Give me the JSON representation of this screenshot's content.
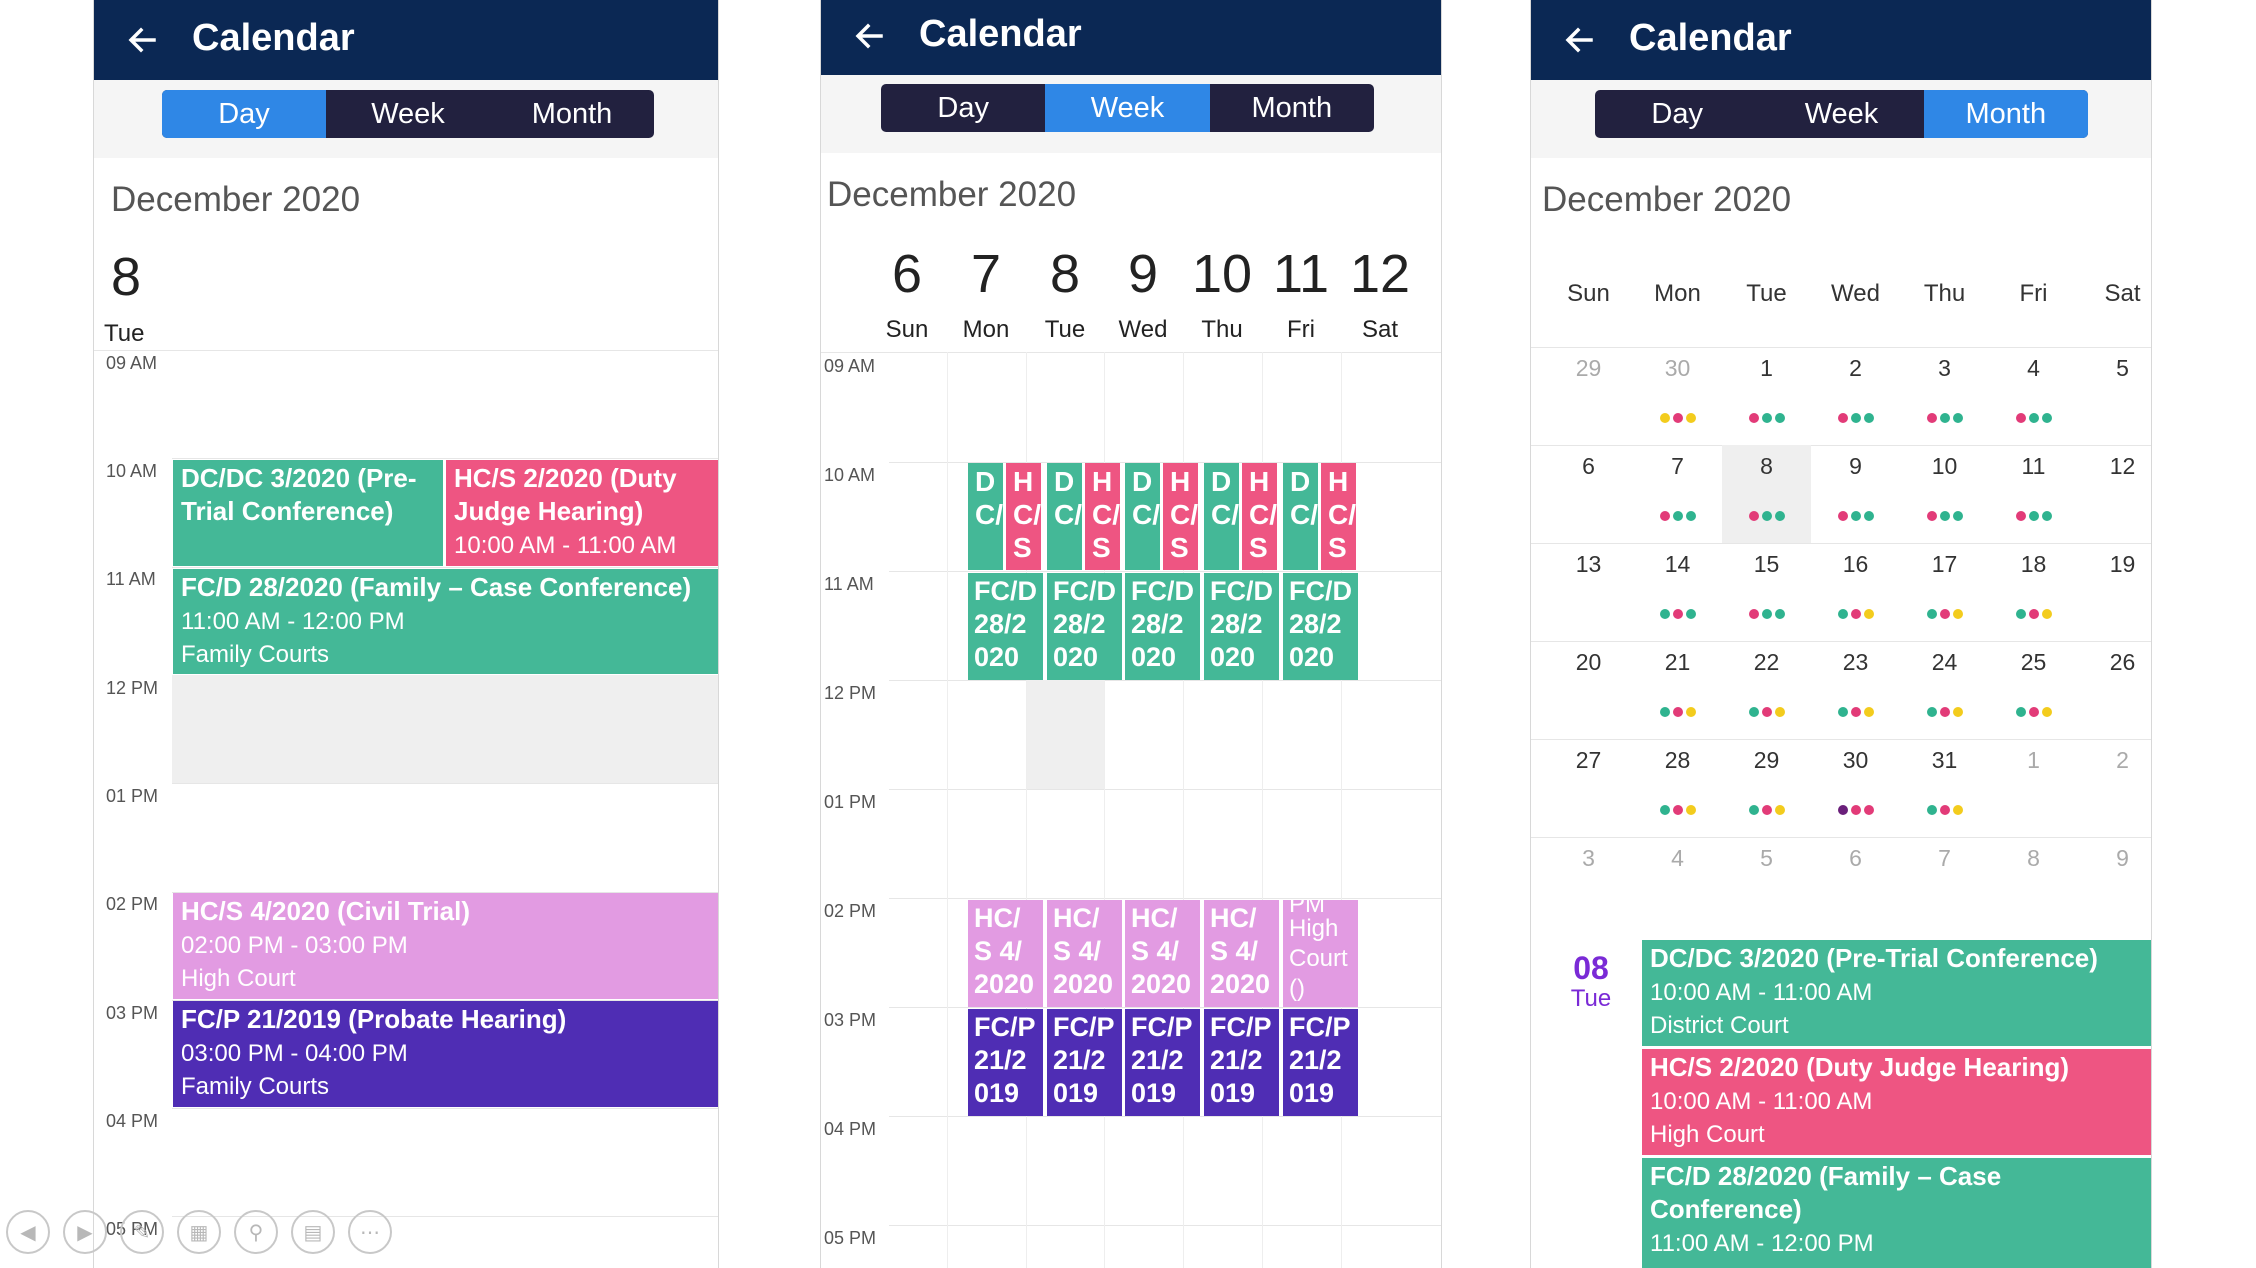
{
  "app": {
    "title": "Calendar"
  },
  "tabs": [
    "Day",
    "Week",
    "Month"
  ],
  "month_title": "December 2020",
  "hours": [
    "09 AM",
    "10 AM",
    "11 AM",
    "12 PM",
    "01 PM",
    "02 PM",
    "03 PM",
    "04 PM",
    "05 PM"
  ],
  "day_view": {
    "active_tab": "Day",
    "date_number": "8",
    "date_weekday": "Tue",
    "events": [
      {
        "title": "DC/DC 3/2020 (Pre-Trial Conference)",
        "time": "",
        "location": "",
        "color": "#44b897"
      },
      {
        "title": "HC/S 2/2020 (Duty Judge Hearing)",
        "time": "10:00 AM - 11:00 AM",
        "location": "",
        "color": "#ee5582"
      },
      {
        "title": "FC/D 28/2020 (Family – Case Conference)",
        "time": "11:00 AM - 12:00 PM",
        "location": "Family Courts",
        "color": "#44b897"
      },
      {
        "title": "HC/S 4/2020 (Civil Trial)",
        "time": "02:00 PM - 03:00 PM",
        "location": "High Court",
        "color": "#e29be2"
      },
      {
        "title": "FC/P 21/2019 (Probate Hearing)",
        "time": "03:00 PM - 04:00 PM",
        "location": "Family Courts",
        "color": "#4f2db4"
      }
    ]
  },
  "week_view": {
    "active_tab": "Week",
    "days": [
      {
        "num": "6",
        "name": "Sun"
      },
      {
        "num": "7",
        "name": "Mon"
      },
      {
        "num": "8",
        "name": "Tue"
      },
      {
        "num": "9",
        "name": "Wed"
      },
      {
        "num": "10",
        "name": "Thu"
      },
      {
        "num": "11",
        "name": "Fri"
      },
      {
        "num": "12",
        "name": "Sat"
      }
    ],
    "row_10am_a": "DC/",
    "row_10am_b": "HC/S",
    "row_11am": "FC/D 28/2 020",
    "row_2pm": "HC/ S 4/ 2020",
    "row_2pm_fri": "High Court ()",
    "row_2pm_fri_top": "PM",
    "row_3pm": "FC/P 21/2 019"
  },
  "month_view": {
    "active_tab": "Month",
    "weekdays": [
      "Sun",
      "Mon",
      "Tue",
      "Wed",
      "Thu",
      "Fri",
      "Sat"
    ],
    "weeks": [
      [
        "29",
        "30",
        "1",
        "2",
        "3",
        "4",
        "5"
      ],
      [
        "6",
        "7",
        "8",
        "9",
        "10",
        "11",
        "12"
      ],
      [
        "13",
        "14",
        "15",
        "16",
        "17",
        "18",
        "19"
      ],
      [
        "20",
        "21",
        "22",
        "23",
        "24",
        "25",
        "26"
      ],
      [
        "27",
        "28",
        "29",
        "30",
        "31",
        "1",
        "2"
      ],
      [
        "3",
        "4",
        "5",
        "6",
        "7",
        "8",
        "9"
      ]
    ],
    "selected_date_number": "08",
    "selected_date_weekday": "Tue",
    "agenda": [
      {
        "title": "DC/DC 3/2020 (Pre-Trial Conference)",
        "time": "10:00 AM - 11:00 AM",
        "location": "District Court",
        "color": "#44b897"
      },
      {
        "title": "HC/S 2/2020 (Duty Judge Hearing)",
        "time": "10:00 AM - 11:00 AM",
        "location": "High Court",
        "color": "#ee5582"
      },
      {
        "title": "FC/D 28/2020 (Family – Case Conference)",
        "time": "11:00 AM - 12:00 PM",
        "location": "",
        "color": "#44b897"
      }
    ]
  },
  "colors": {
    "appbar": "#0b2854",
    "tab_active": "#2f87e6",
    "tab_bg": "#22213f",
    "dot_teal": "#2fb38f",
    "dot_pink": "#e23b78",
    "dot_yellow": "#f3cc1d",
    "dot_purple": "#6a1f7a",
    "selected_day": "#7a2ad6"
  },
  "icons": [
    "arrow-left-icon",
    "prev-icon",
    "next-icon",
    "pen-icon",
    "slides-icon",
    "zoom-icon",
    "subtitles-icon",
    "more-icon"
  ]
}
